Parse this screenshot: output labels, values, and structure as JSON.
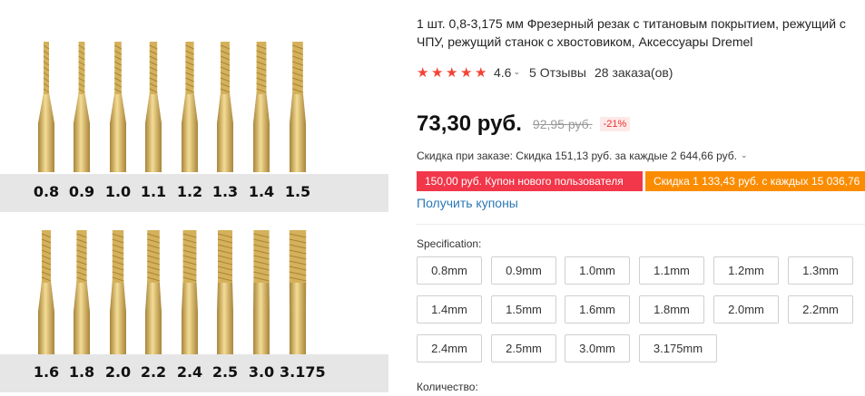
{
  "product_image": {
    "row1_sizes": [
      "0.8",
      "0.9",
      "1.0",
      "1.1",
      "1.2",
      "1.3",
      "1.4",
      "1.5"
    ],
    "row2_sizes": [
      "1.6",
      "1.8",
      "2.0",
      "2.2",
      "2.4",
      "2.5",
      "3.0",
      "3.175"
    ],
    "colors": {
      "gold": "#d4b15a",
      "gold_dark": "#a9843a",
      "band": "#e6e6e6"
    }
  },
  "product": {
    "title_line1": "1 шт. 0,8-3,175 мм Фрезерный резак с титановым покрытием, режущий с",
    "title_line2": "ЧПУ, режущий станок с хвостовиком, Аксессуары Dremel"
  },
  "rating": {
    "stars": 5,
    "value": "4.6",
    "reviews": "5 Отзывы",
    "orders": "28 заказа(ов)",
    "star_color": "#f44336"
  },
  "price": {
    "current": "73,30 руб.",
    "old": "92,95 руб.",
    "discount": "-21%"
  },
  "bulk": {
    "text": "Скидка при заказе: Скидка 151,13 руб. за каждые 2 644,66 руб."
  },
  "coupons": {
    "new_user": "150,00 руб. Купон нового пользователя",
    "bulk": "Скидка 1 133,43 руб. с каждых 15 036,76",
    "get_link": "Получить купоны"
  },
  "specification": {
    "label": "Specification:",
    "options": [
      "0.8mm",
      "0.9mm",
      "1.0mm",
      "1.1mm",
      "1.2mm",
      "1.3mm",
      "1.4mm",
      "1.5mm",
      "1.6mm",
      "1.8mm",
      "2.0mm",
      "2.2mm",
      "2.4mm",
      "2.5mm",
      "3.0mm",
      "3.175mm"
    ]
  },
  "quantity": {
    "label": "Количество:"
  }
}
